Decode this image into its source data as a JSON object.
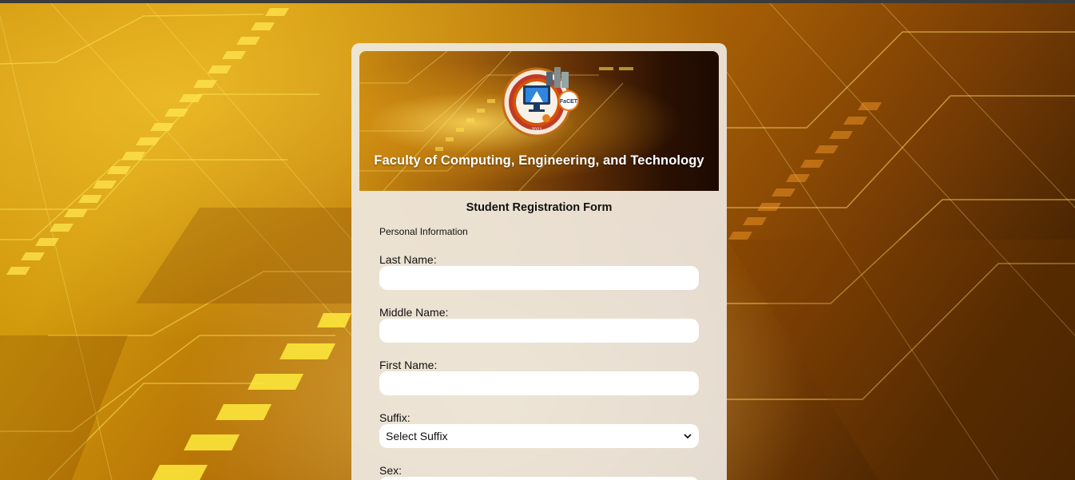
{
  "page": {
    "banner_title": "Faculty of Computing, Engineering, and Technology",
    "logo_badge": "FaCET",
    "logo_year": "2021"
  },
  "form": {
    "title": "Student Registration Form",
    "section": "Personal Information",
    "fields": {
      "last_name": {
        "label": "Last Name:",
        "value": ""
      },
      "middle_name": {
        "label": "Middle Name:",
        "value": ""
      },
      "first_name": {
        "label": "First Name:",
        "value": ""
      },
      "suffix": {
        "label": "Suffix:",
        "selected": "Select Suffix"
      },
      "sex": {
        "label": "Sex:"
      }
    }
  },
  "colors": {
    "background_accent": "#c98d06",
    "card": "#f0ebe6",
    "banner_dark": "#1e0a01"
  }
}
